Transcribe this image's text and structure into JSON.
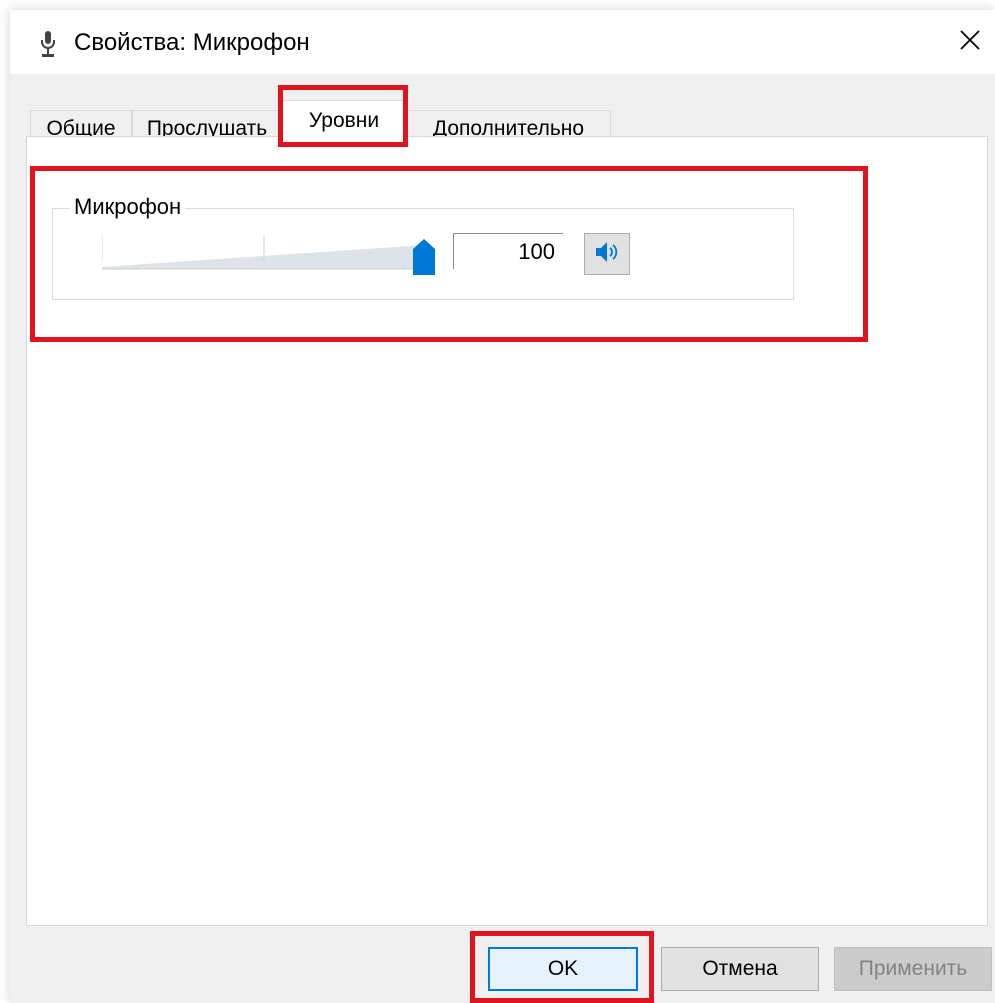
{
  "window": {
    "title": "Свойства: Микрофон",
    "close_glyph": "✕"
  },
  "tabs": [
    {
      "label": "Общие",
      "active": false
    },
    {
      "label": "Прослушать",
      "active": false
    },
    {
      "label": "Уровни",
      "active": true
    },
    {
      "label": "Дополнительно",
      "active": false
    }
  ],
  "levels": {
    "group_label": "Микрофон",
    "level_value": "100",
    "slider_fraction": 1.0
  },
  "buttons": {
    "ok": "OK",
    "cancel": "Отмена",
    "apply": "Применить"
  },
  "icons": {
    "title": "microphone-icon",
    "mute": "speaker-icon",
    "close": "close-icon"
  },
  "colors": {
    "accent": "#0078d7",
    "highlight": "#e0141f"
  }
}
